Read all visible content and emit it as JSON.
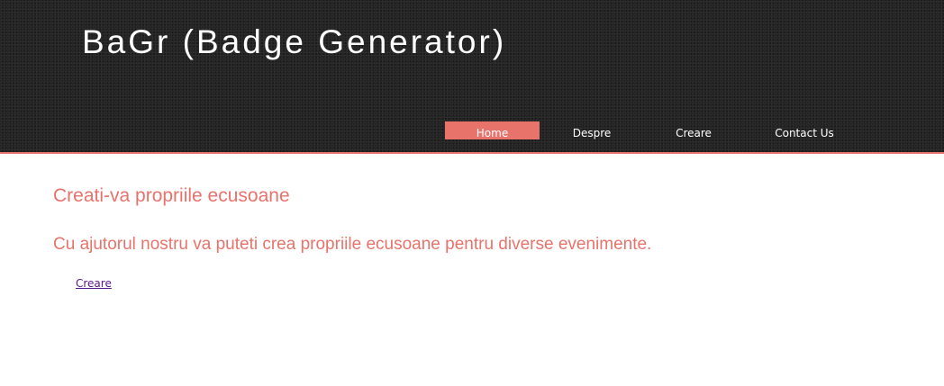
{
  "header": {
    "title": "BaGr (Badge Generator)"
  },
  "nav": {
    "items": [
      {
        "label": "Home",
        "active": true
      },
      {
        "label": "Despre",
        "active": false
      },
      {
        "label": "Creare",
        "active": false
      },
      {
        "label": "Contact Us",
        "active": false
      }
    ]
  },
  "main": {
    "heading": "Creati-va propriile ecusoane",
    "intro": "Cu ajutorul nostru va puteti crea propriile ecusoane pentru diverse evenimente.",
    "link_label": "Creare"
  },
  "colors": {
    "accent": "#e8736b",
    "header_bg": "#242424",
    "visited_link": "#551a8b"
  }
}
